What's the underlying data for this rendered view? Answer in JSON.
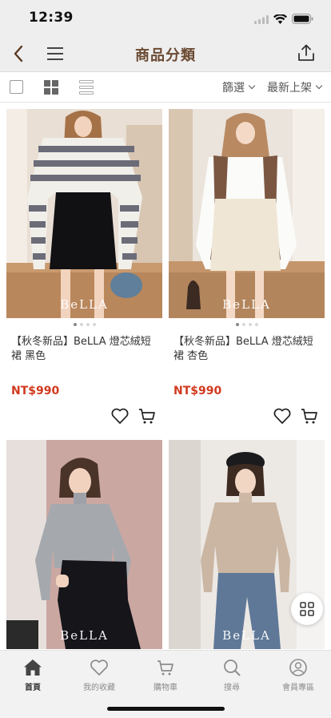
{
  "status": {
    "time": "12:39"
  },
  "nav": {
    "title": "商品分類"
  },
  "toolbar": {
    "filter_label": "篩選",
    "sort_label": "最新上架"
  },
  "products": [
    {
      "name": "【秋冬新品】BeLLA 燈芯絨短裙 黑色",
      "price": "NT$990",
      "brand": "BeLLA"
    },
    {
      "name": "【秋冬新品】BeLLA 燈芯絨短裙 杏色",
      "price": "NT$990",
      "brand": "BeLLA"
    },
    {
      "brand": "BeLLA"
    },
    {
      "brand": "BeLLA"
    }
  ],
  "tabs": [
    {
      "label": "首頁",
      "icon": "home-icon",
      "active": true
    },
    {
      "label": "我的收藏",
      "icon": "heart-icon"
    },
    {
      "label": "購物車",
      "icon": "cart-icon"
    },
    {
      "label": "搜尋",
      "icon": "search-icon"
    },
    {
      "label": "會員專區",
      "icon": "user-icon"
    }
  ],
  "colors": {
    "title": "#6b4a32",
    "price": "#d1391e",
    "bar_bg": "#eeeeee"
  }
}
